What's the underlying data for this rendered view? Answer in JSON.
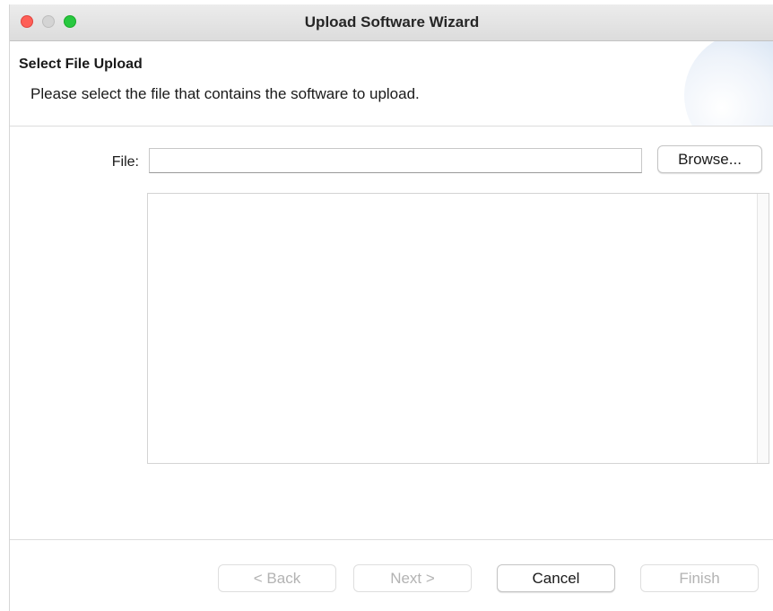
{
  "window": {
    "title": "Upload Software Wizard"
  },
  "header": {
    "title": "Select File Upload",
    "description": "Please select the file that contains the software to upload."
  },
  "file_field": {
    "label": "File:",
    "value": "",
    "placeholder": ""
  },
  "browse_button": {
    "label": "Browse..."
  },
  "file_list": {
    "items": []
  },
  "footer": {
    "back_label": "< Back",
    "next_label": "Next >",
    "cancel_label": "Cancel",
    "finish_label": "Finish",
    "back_enabled": false,
    "next_enabled": false,
    "cancel_enabled": true,
    "finish_enabled": false
  },
  "colors": {
    "close": "#fe5f57",
    "minimize": "#d4d4d4",
    "maximize": "#28c840",
    "disabled_text": "#b3b3b3"
  }
}
